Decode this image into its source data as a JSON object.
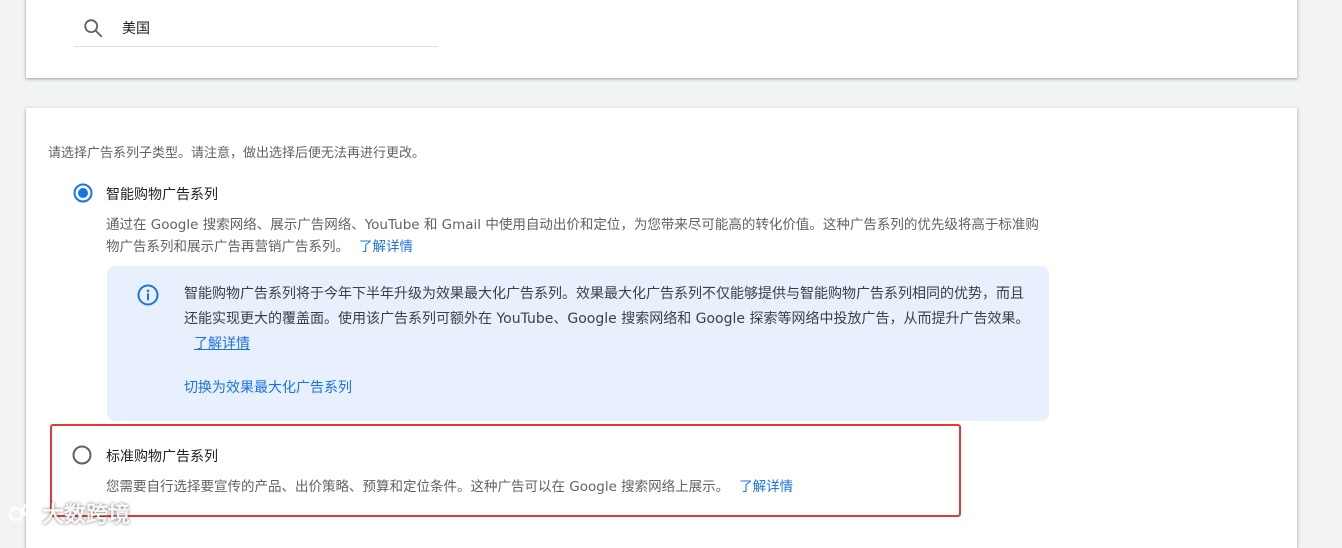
{
  "search": {
    "value": "美国"
  },
  "subtype": {
    "instruction": "请选择广告系列子类型。请注意，做出选择后便无法再进行更改。",
    "smart": {
      "title": "智能购物广告系列",
      "selected": true,
      "description": "通过在 Google 搜索网络、展示广告网络、YouTube 和 Gmail 中使用自动出价和定位，为您带来尽可能高的转化价值。这种广告系列的优先级将高于标准购物广告系列和展示广告再营销广告系列。",
      "learn_more": "了解详情"
    },
    "notice": {
      "text": "智能购物广告系列将于今年下半年升级为效果最大化广告系列。效果最大化广告系列不仅能够提供与智能购物广告系列相同的优势，而且还能实现更大的覆盖面。使用该广告系列可额外在 YouTube、Google 搜索网络和 Google 探索等网络中投放广告，从而提升广告效果。",
      "learn_more": "了解详情",
      "action": "切换为效果最大化广告系列"
    },
    "standard": {
      "title": "标准购物广告系列",
      "selected": false,
      "description": "您需要自行选择要宣传的产品、出价策略、预算和定位条件。这种广告可以在 Google 搜索网络上展示。",
      "learn_more": "了解详情"
    }
  },
  "watermark": {
    "text": "大数跨境"
  },
  "colors": {
    "accent": "#1a73e8",
    "highlight": "#e53935",
    "info_bg": "#e8f0fe"
  }
}
